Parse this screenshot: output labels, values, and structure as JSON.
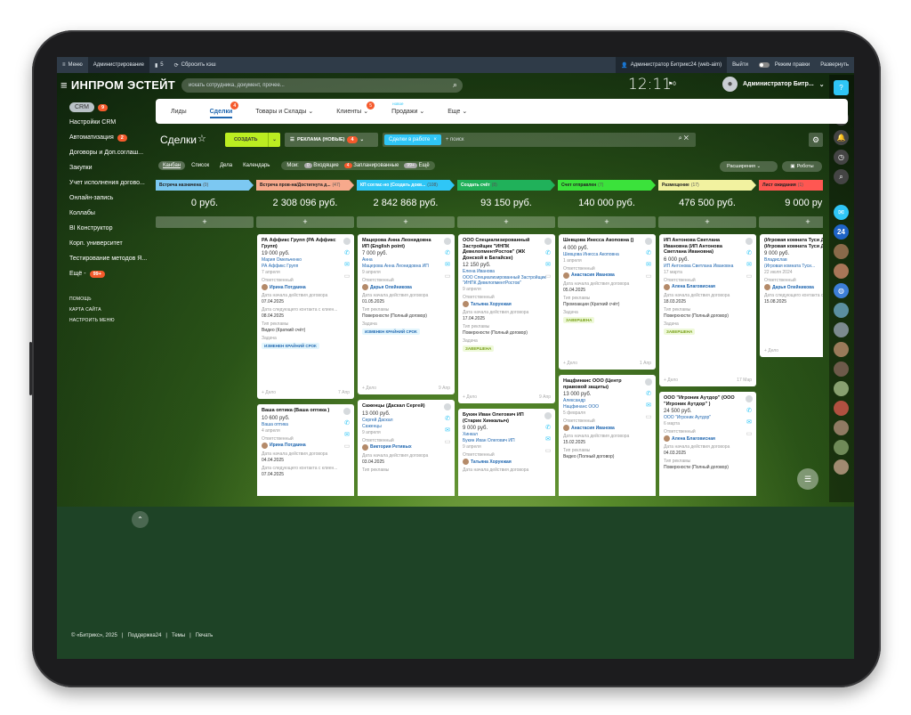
{
  "topbar": {
    "menu": "Меню",
    "admin": "Администрирование",
    "counter": "5",
    "reset": "Сбросить кэш",
    "user_portal": "Администратор Битрикс24 (web-aim)",
    "logout": "Выйти",
    "edit_mode": "Режим правки",
    "expand": "Развернуть"
  },
  "header": {
    "logo": "ИНПРОМ ЭСТЕЙТ",
    "search_placeholder": "искать сотрудника, документ, прочее...",
    "clock": "12:11",
    "flag": "0",
    "user": "Администратор Битр..."
  },
  "left_menu": {
    "items": [
      {
        "label": "CRM",
        "badge": "9"
      },
      {
        "label": "Настройки CRM",
        "badge": ""
      },
      {
        "label": "Автоматизация",
        "badge": "2"
      },
      {
        "label": "Договоры и Доп.соглаш...",
        "badge": ""
      },
      {
        "label": "Закупки",
        "badge": ""
      },
      {
        "label": "Учет исполнения догово...",
        "badge": ""
      },
      {
        "label": "Онлайн-запись",
        "badge": ""
      },
      {
        "label": "Коллабы",
        "badge": ""
      },
      {
        "label": "BI Конструктор",
        "badge": ""
      },
      {
        "label": "Корп. университет",
        "badge": ""
      },
      {
        "label": "Тестирование методов Я...",
        "badge": ""
      },
      {
        "label": "Ещё -",
        "badge": "99+"
      }
    ],
    "small": [
      "ПОМОЩЬ",
      "КАРТА САЙТА",
      "НАСТРОИТЬ МЕНЮ"
    ]
  },
  "tabs": [
    {
      "label": "Лиды",
      "badge": "",
      "new": ""
    },
    {
      "label": "Сделки",
      "badge": "4",
      "new": ""
    },
    {
      "label": "Товары и Склады ⌄",
      "badge": "",
      "new": ""
    },
    {
      "label": "Клиенты ⌄",
      "badge": "5",
      "new": ""
    },
    {
      "label": "Продажи ⌄",
      "badge": "",
      "new": "новое"
    },
    {
      "label": "Еще ⌄",
      "badge": "",
      "new": ""
    }
  ],
  "toolbar": {
    "title": "Сделки",
    "create": "СОЗДАТЬ",
    "pipeline": "РЕКЛАМА (НОВЫЕ)",
    "pipeline_badge": "4",
    "filter_chip": "Сделки в работе",
    "filter_placeholder": "+ поиск"
  },
  "views": {
    "items": [
      "Канбан",
      "Список",
      "Дела",
      "Календарь"
    ],
    "my": "Мои:",
    "incoming": "Входящие",
    "incoming_count": "0",
    "planned": "Запланированные",
    "planned_count": "4",
    "more": "Ещё",
    "more_count": "99+",
    "extensions": "Расширения",
    "robots": "Роботы"
  },
  "columns": [
    {
      "title": "Встреча назначена",
      "count": "(0)",
      "sum": "0 руб.",
      "color": "#7cc8f2"
    },
    {
      "title": "Встреча пров-на/Достигнута д...",
      "count": "(47)",
      "sum": "2 308 096 руб.",
      "color": "#f7a98c"
    },
    {
      "title": "КП соглас-но (Создать докв...",
      "count": "(108)",
      "sum": "2 842 868 руб.",
      "color": "#2fc6f6"
    },
    {
      "title": "Создать счёт",
      "count": "(8)",
      "sum": "93 150 руб.",
      "color": "#20b15a"
    },
    {
      "title": "Счет отправлен",
      "count": "(7)",
      "sum": "140 000 руб.",
      "color": "#3be23b"
    },
    {
      "title": "Размещение",
      "count": "(17)",
      "sum": "476 500 руб.",
      "color": "#f2f2a0"
    },
    {
      "title": "Лист ожидания",
      "count": "(1)",
      "sum": "9 000 руб.",
      "color": "#ff5752"
    }
  ],
  "cards": [
    {
      "col": 1,
      "title": "РА Аффикс Групп (РА Аффикс Групп)",
      "sum": "19 000 руб.",
      "links": [
        "Мария Омельченко",
        "РА Аффикс Групп"
      ],
      "date": "7 апреля",
      "resp": "Ирина Потдаина",
      "f1": "Дата начала действия договора",
      "v1": "07.04.2025",
      "f2": "Дата следующего контакта с клиен...",
      "v2": "08.04.2025",
      "f3": "Тип рекламы",
      "v3": "Видео (Краткий счёт)",
      "f4": "Задача",
      "tag": "ИЗМЕНЕН КРАЙНИЙ СРОК",
      "tagdone": false,
      "deal": "+ Дело",
      "when": "7 Апр"
    },
    {
      "col": 1,
      "title": "Ваша оптика (Ваша оптика )",
      "sum": "10 600 руб.",
      "links": [
        "Ваша оптика"
      ],
      "date": "4 апреля",
      "resp": "Ирина Потдаина",
      "f1": "Дата начала действия договора",
      "v1": "04.04.2025",
      "f2": "Дата следующего контакта с клиен...",
      "v2": "07.04.2025",
      "f3": "",
      "v3": "",
      "f4": "",
      "tag": "",
      "tagdone": false,
      "deal": "",
      "when": ""
    },
    {
      "col": 2,
      "title": "Мацерова Анна Леонидовна ИП (English point)",
      "sum": "7 000 руб.",
      "links": [
        "Анна",
        "Мацерова Анна Леонидовна ИП"
      ],
      "date": "9 апреля",
      "resp": "Дарья Олейникова",
      "f1": "Дата начала действия договора",
      "v1": "01.05.2025",
      "f2": "Тип рекламы",
      "v2": "Поверхности (Полный договор)",
      "f3": "",
      "v3": "",
      "f4": "Задача",
      "tag": "ИЗМЕНЕН КРАЙНИЙ СРОК",
      "tagdone": false,
      "deal": "+ Дело",
      "when": "9 Апр"
    },
    {
      "col": 2,
      "title": "Саженцы (Даскал Сергей)",
      "sum": "13 000 руб.",
      "links": [
        "Сергей Даскал",
        "Саженцы"
      ],
      "date": "9 апреля",
      "resp": "Виктория Ретивых",
      "f1": "Дата начала действия договора",
      "v1": "03.04.2025",
      "f2": "Тип рекламы",
      "v2": "",
      "f3": "",
      "v3": "",
      "f4": "",
      "tag": "",
      "tagdone": false,
      "deal": "",
      "when": ""
    },
    {
      "col": 3,
      "title": "ООО Специализированный Застройщик \"ИНПК ДевелопментРостов\" (ЖК Донской в Батайске)",
      "sum": "12 150 руб.",
      "links": [
        "Елена Иванова",
        "ООО Специализированный Застройщик \"ИНПК ДевелопментРостов\""
      ],
      "date": "9 апреля",
      "resp": "Татьяна Хорунжая",
      "f1": "Дата начала действия договора",
      "v1": "17.04.2025",
      "f2": "Тип рекламы",
      "v2": "Поверхности (Полный договор)",
      "f3": "",
      "v3": "",
      "f4": "Задача",
      "tag": "ЗАВЕРШЕНА",
      "tagdone": true,
      "deal": "+ Дело",
      "when": "9 Апр"
    },
    {
      "col": 3,
      "title": "Букин Иван Олегович ИП (Старик Хинкалыч)",
      "sum": "9 000 руб.",
      "links": [
        "Хинкал",
        "Букин Иван Олегович ИП"
      ],
      "date": "9 апреля",
      "resp": "Татьяна Хорунжая",
      "f1": "Дата начала действия договора",
      "v1": "",
      "f2": "",
      "v2": "",
      "f3": "",
      "v3": "",
      "f4": "",
      "tag": "",
      "tagdone": false,
      "deal": "",
      "when": ""
    },
    {
      "col": 4,
      "title": "Шевцова Инесса Акоповна ()",
      "sum": "4 000 руб.",
      "links": [
        "Шевцова Инесса Акоповна"
      ],
      "date": "1 апреля",
      "resp": "Анастасия Иванова",
      "f1": "Дата начала действия договора",
      "v1": "05.04.2025",
      "f2": "Тип рекламы",
      "v2": "Промоакции (Краткий счёт)",
      "f3": "",
      "v3": "",
      "f4": "Задача",
      "tag": "ЗАВЕРШЕНА",
      "tagdone": true,
      "deal": "+ Дело",
      "when": "1 Апр"
    },
    {
      "col": 4,
      "title": "Нацфинанс ООО (Центр правовой защиты)",
      "sum": "13 000 руб.",
      "links": [
        "Александр",
        "Нацфинанс ООО"
      ],
      "date": "5 февраля",
      "resp": "Анастасия Иванова",
      "f1": "Дата начала действия договора",
      "v1": "15.02.2025",
      "f2": "Тип рекламы",
      "v2": "Видео (Полный договор)",
      "f3": "",
      "v3": "",
      "f4": "",
      "tag": "",
      "tagdone": false,
      "deal": "+ Дело",
      "when": "7 Фев"
    },
    {
      "col": 5,
      "title": "ИП Антонова Светлана Ивановна (ИП Антонова Светлана Ивановна)",
      "sum": "6 000 руб.",
      "links": [
        "ИП Антонова Светлана Ивановна"
      ],
      "date": "17 марта",
      "resp": "Алена Благовисная",
      "f1": "Дата начала действия договора",
      "v1": "18.03.2025",
      "f2": "Тип рекламы",
      "v2": "Поверхности (Полный договор)",
      "f3": "",
      "v3": "",
      "f4": "Задача",
      "tag": "ЗАВЕРШЕНА",
      "tagdone": true,
      "deal": "+ Дело",
      "when": "17 Мар"
    },
    {
      "col": 5,
      "title": "ООО \"Игроник Аутдор\" (ООО \"Игроник Аутдор\" )",
      "sum": "24 500 руб.",
      "links": [
        "ООО \"Игроник Аутдор\""
      ],
      "date": "6 марта",
      "resp": "Алена Благовисная",
      "f1": "Дата начала действия договора",
      "v1": "04.03.2025",
      "f2": "Тип рекламы",
      "v2": "Поверхности (Полный договор)",
      "f3": "",
      "v3": "",
      "f4": "",
      "tag": "",
      "tagdone": false,
      "deal": "",
      "when": ""
    },
    {
      "col": 6,
      "title": "(Игровая комната Туси Джуси) (Игровая комната Туси Джуси)",
      "sum": "9 000 руб.",
      "links": [
        "Владислав",
        "(Игровая комната Туси..."
      ],
      "date": "22 июля 2024",
      "resp": "Дарья Олейникова",
      "f1": "Дата следующего контакта с...",
      "v1": "15.08.2025",
      "f2": "",
      "v2": "",
      "f3": "",
      "v3": "",
      "f4": "",
      "tag": "",
      "tagdone": false,
      "deal": "+ Дело",
      "when": "22 Июл"
    }
  ],
  "labels": {
    "responsible": "Ответственный"
  },
  "footer": [
    "© «Битрикс», 2025",
    "Поддержка24",
    "Темы",
    "Печать"
  ]
}
